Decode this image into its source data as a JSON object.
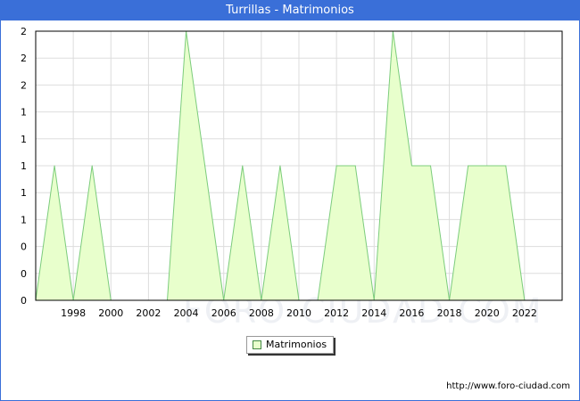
{
  "header": {
    "title": "Turrillas - Matrimonios"
  },
  "footer": {
    "url": "http://www.foro-ciudad.com"
  },
  "watermark": {
    "text": "FORO-CIUDAD.COM"
  },
  "colors": {
    "area_fill": "#e8ffcc",
    "area_stroke": "#7ccc7c",
    "title_bar": "#3a6fd8",
    "grid": "#dddddd"
  },
  "chart_data": {
    "type": "area",
    "title": "Turrillas - Matrimonios",
    "xlabel": "",
    "ylabel": "",
    "x": [
      1996,
      1997,
      1998,
      1999,
      2000,
      2001,
      2002,
      2003,
      2004,
      2005,
      2006,
      2007,
      2008,
      2009,
      2010,
      2011,
      2012,
      2013,
      2014,
      2015,
      2016,
      2017,
      2018,
      2019,
      2020,
      2021,
      2022
    ],
    "series": [
      {
        "name": "Matrimonios",
        "values": [
          0,
          1,
          0,
          1,
          0,
          0,
          0,
          0,
          2,
          1,
          0,
          1,
          0,
          1,
          0,
          0,
          1,
          1,
          0,
          2,
          1,
          1,
          0,
          1,
          1,
          1,
          0
        ]
      }
    ],
    "xlim": [
      1996,
      2024
    ],
    "ylim": [
      0,
      2
    ],
    "x_tick_labels": [
      "1998",
      "2000",
      "2002",
      "2004",
      "2006",
      "2008",
      "2010",
      "2012",
      "2014",
      "2016",
      "2018",
      "2020",
      "2022"
    ],
    "y_tick_labels": [
      "0",
      "0",
      "0",
      "1",
      "1",
      "1",
      "1",
      "1",
      "2",
      "2",
      "2"
    ],
    "grid": true,
    "legend": {
      "position": "bottom-center",
      "entries": [
        "Matrimonios"
      ]
    }
  }
}
